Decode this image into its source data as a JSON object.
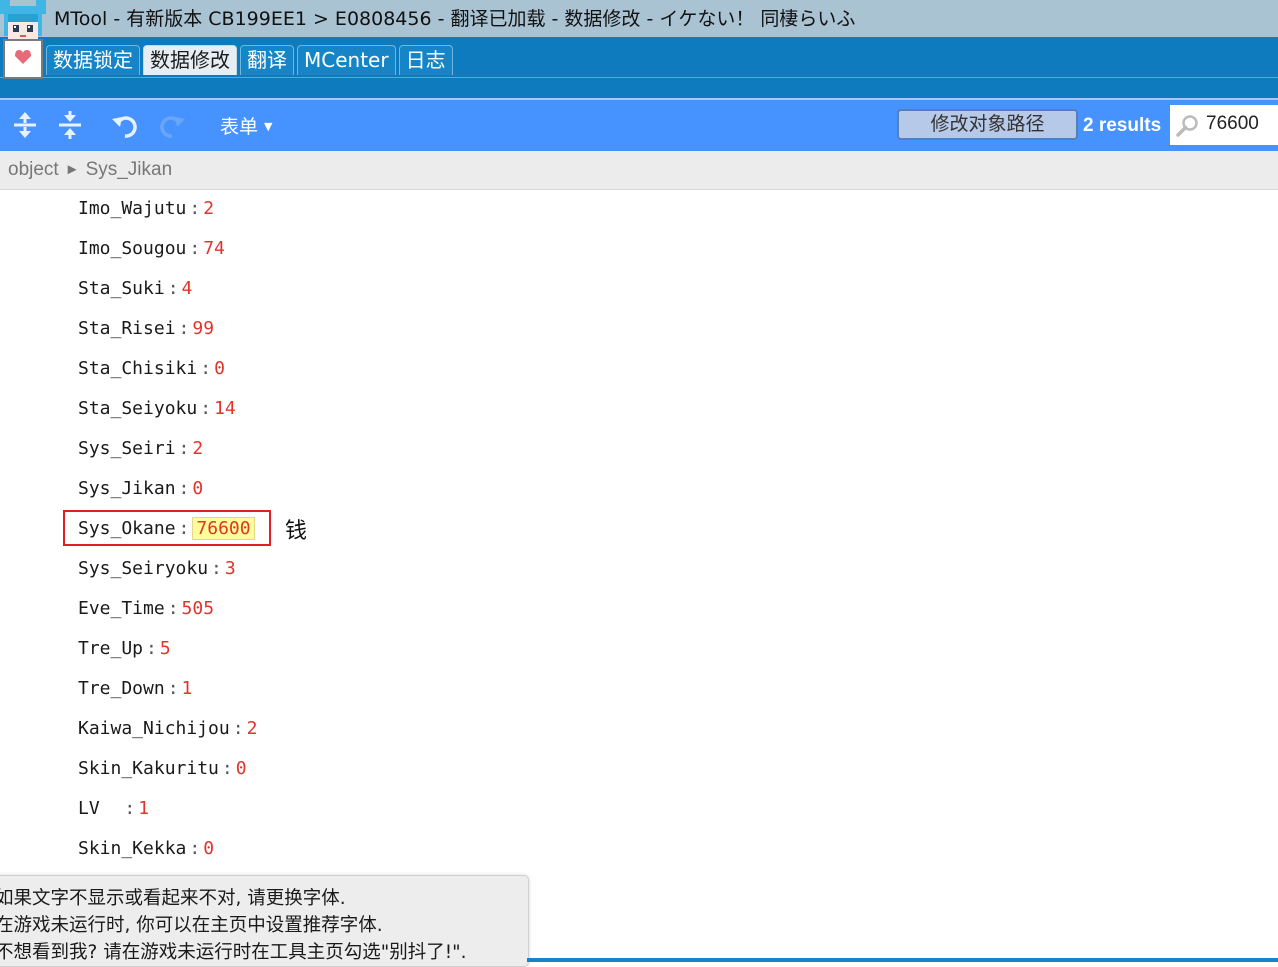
{
  "window": {
    "title": "MTool - 有新版本 CB199EE1 > E0808456 - 翻译已加载 - 数据修改 - イケない！ 同棲らいふ"
  },
  "tabs": [
    {
      "label": "数据锁定",
      "active": false
    },
    {
      "label": "数据修改",
      "active": true
    },
    {
      "label": "翻译",
      "active": false
    },
    {
      "label": "MCenter",
      "active": false
    },
    {
      "label": "日志",
      "active": false
    }
  ],
  "toolbar": {
    "icons": [
      "expand-all-icon",
      "collapse-all-icon",
      "undo-icon",
      "redo-icon"
    ],
    "menu_label": "表单",
    "path_button": "修改对象路径",
    "results": "2 results",
    "search_value": "76600"
  },
  "breadcrumb": {
    "root": "object",
    "separator": "►",
    "current": "Sys_Jikan"
  },
  "rows": [
    {
      "key": "Imo_Wajutu",
      "value": "2"
    },
    {
      "key": "Imo_Sougou",
      "value": "74"
    },
    {
      "key": "Sta_Suki",
      "value": "4"
    },
    {
      "key": "Sta_Risei",
      "value": "99"
    },
    {
      "key": "Sta_Chisiki",
      "value": "0"
    },
    {
      "key": "Sta_Seiyoku",
      "value": "14"
    },
    {
      "key": "Sys_Seiri",
      "value": "2"
    },
    {
      "key": "Sys_Jikan",
      "value": "0"
    },
    {
      "key": "Sys_Okane",
      "value": "76600",
      "highlighted": true
    },
    {
      "key": "Sys_Seiryoku",
      "value": "3"
    },
    {
      "key": "Eve_Time",
      "value": "505"
    },
    {
      "key": "Tre_Up",
      "value": "5"
    },
    {
      "key": "Tre_Down",
      "value": "1"
    },
    {
      "key": "Kaiwa_Nichijou",
      "value": "2"
    },
    {
      "key": "Skin_Kakuritu",
      "value": "0"
    },
    {
      "key": "LV  ",
      "value": "1"
    },
    {
      "key": "Skin_Kekka",
      "value": "0"
    }
  ],
  "annotation": {
    "note": "钱",
    "color": "#e02020"
  },
  "tooltip": {
    "line1": "如果文字不显示或看起来不对, 请更换字体.",
    "line2": "在游戏未运行时, 你可以在主页中设置推荐字体.",
    "line3": "不想看到我? 请在游戏未运行时在工具主页勾选\"别抖了!\"."
  },
  "colors": {
    "title_bg": "#a9c3d3",
    "tab_strip": "#0f7bbf",
    "toolbar": "#4693ff",
    "value_text": "#e0352b",
    "highlight_bg": "#ffff9a"
  }
}
